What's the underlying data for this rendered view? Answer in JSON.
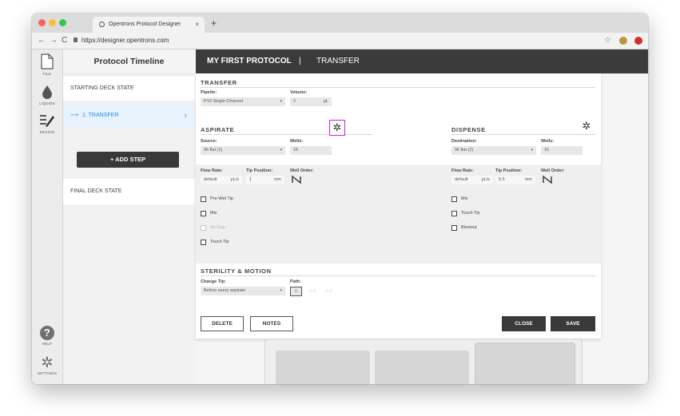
{
  "browser": {
    "tab_title": "Opentrons Protocol Designer",
    "tab_close": "×",
    "new_tab": "+",
    "url": "https://designer.opentrons.com",
    "back": "←",
    "forward": "→",
    "reload": "C",
    "bookmark": "☆",
    "traffic_colors": [
      "#fc605c",
      "#fdbc40",
      "#34c84a"
    ]
  },
  "navrail": {
    "file": "FILE",
    "liquids": "LIQUIDS",
    "design": "DESIGN",
    "help": "HELP",
    "help_glyph": "?",
    "settings": "SETTINGS",
    "settings_glyph": "✲"
  },
  "timeline": {
    "title": "Protocol Timeline",
    "starting": "STARTING DECK STATE",
    "step_arrow": "⟶",
    "step": "1. TRANSFER",
    "step_chevron": "›",
    "add_step": "+ ADD STEP",
    "final": "FINAL DECK STATE",
    "accent": "#1f8fe5"
  },
  "header": {
    "protocol": "MY FIRST PROTOCOL",
    "separator": "|",
    "step_type": "TRANSFER"
  },
  "form": {
    "transfer_title": "TRANSFER",
    "pipette_label": "Pipette:",
    "pipette_value": "P10 Single-Channel",
    "volume_label": "Volume:",
    "volume_value": "2",
    "volume_unit": "μL",
    "caret": "▾",
    "gear_glyph": "✲",
    "highlight_color": "#d21cde",
    "aspirate": {
      "title": "ASPIRATE",
      "source_label": "Source:",
      "source_value": "96 flat (1)",
      "wells_label": "Wells:",
      "wells_value": "16",
      "flow_rate_label": "Flow Rate:",
      "flow_rate_value": "default",
      "flow_rate_unit": "μL/s",
      "tip_position_label": "Tip Position:",
      "tip_position_value": "1",
      "tip_position_unit": "mm",
      "well_order_label": "Well Order:",
      "options": [
        {
          "label": "Pre-Wet Tip",
          "disabled": false
        },
        {
          "label": "Mix",
          "disabled": false
        },
        {
          "label": "Air Gap",
          "disabled": true
        },
        {
          "label": "Touch Tip",
          "disabled": false
        }
      ]
    },
    "dispense": {
      "title": "DISPENSE",
      "destination_label": "Destination:",
      "destination_value": "96 flat (2)",
      "wells_label": "Wells:",
      "wells_value": "16",
      "flow_rate_label": "Flow Rate:",
      "flow_rate_value": "default",
      "flow_rate_unit": "μL/s",
      "tip_position_label": "Tip Position:",
      "tip_position_value": "0.5",
      "tip_position_unit": "mm",
      "well_order_label": "Well Order:",
      "options": [
        {
          "label": "Mix",
          "disabled": false
        },
        {
          "label": "Touch Tip",
          "disabled": false
        },
        {
          "label": "Blowout",
          "disabled": false
        }
      ]
    },
    "sterility": {
      "title": "STERILITY & MOTION",
      "change_tip_label": "Change Tip:",
      "change_tip_value": "Before every aspirate",
      "path_label": "Path:",
      "path_options": [
        "∩",
        "∩∩",
        "∩∩"
      ]
    },
    "buttons": {
      "delete": "DELETE",
      "notes": "NOTES",
      "close": "CLOSE",
      "save": "SAVE"
    }
  }
}
